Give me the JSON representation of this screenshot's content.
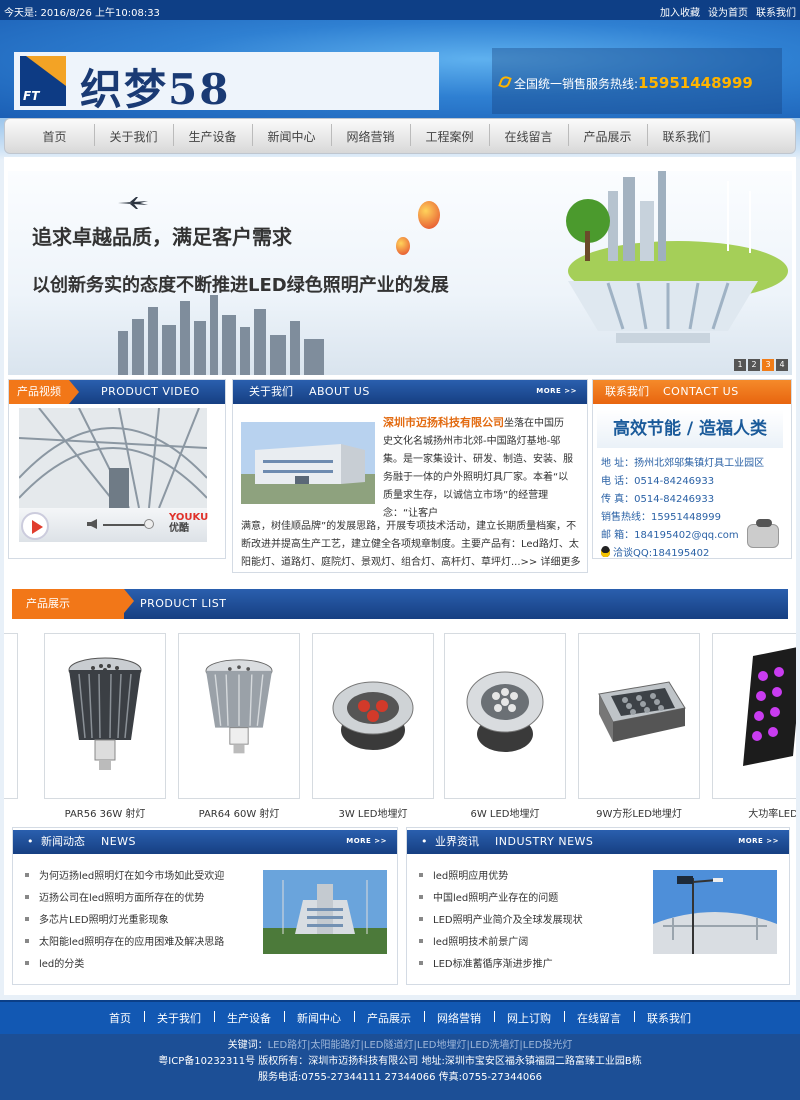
{
  "topbar": {
    "date": "今天是: 2016/8/26 上午10:08:33",
    "links": [
      "加入收藏",
      "设为首页",
      "联系我们"
    ]
  },
  "header": {
    "logo_text": "织梦58",
    "logo_mark": "FT",
    "hotline_label": "全国统一销售服务热线:",
    "hotline_number": "15951448999"
  },
  "nav": [
    "首页",
    "关于我们",
    "生产设备",
    "新闻中心",
    "网络营销",
    "工程案例",
    "在线留言",
    "产品展示",
    "联系我们"
  ],
  "banner": {
    "headline": "追求卓越品质，满足客户需求",
    "subline": "以创新务实的态度不断推进LED绿色照明产业的发展",
    "slides": [
      "1",
      "2",
      "3",
      "4"
    ],
    "active_slide": 3
  },
  "video": {
    "tag": "产品视频",
    "en": "PRODUCT VIDEO",
    "player_brand": "YOUKU",
    "player_brand_cn": "优酷"
  },
  "about": {
    "tag": "关于我们",
    "en": "ABOUT US",
    "more": "MORE >>",
    "company": "深圳市迈扬科技有限公司",
    "text_side": "坐落在中国历史文化名城扬州市北郊-中国路灯基地-邬集。是一家集设计、研发、制造、安装、服务融于一体的户外照明灯具厂家。本着“以质量求生存，以诚信立市场”的经营理念：“让客户",
    "text_full": "满意，树佳顺品牌”的发展思路，开展专项技术活动，建立长期质量档案，不断改进并提高生产工艺，建立健全各项规章制度。主要产品有：Led路灯、太阳能灯、道路灯、庭院灯、景观灯、组合灯、高杆灯、草坪灯...>> 详细更多"
  },
  "contact": {
    "tag": "联系我们",
    "en": "CONTACT US",
    "slogan": "高效节能 / 造福人类",
    "lines": [
      "地  址：扬州北郊邬集镇灯具工业园区",
      "电  话：0514-84246933",
      "传  真：0514-84246933",
      "销售热线：15951448999",
      "邮  箱：184195402@qq.com",
      "洽谈QQ:184195402"
    ]
  },
  "products": {
    "tag": "产品展示",
    "en": "PRODUCT LIST",
    "items": [
      "PAR56 36W 射灯",
      "PAR64 60W 射灯",
      "3W LED地埋灯",
      "6W LED地埋灯",
      "9W方形LED地埋灯",
      "大功率LED"
    ]
  },
  "news": {
    "title": "新闻动态",
    "en": "NEWS",
    "more": "MORE >>",
    "items": [
      "为何迈扬led照明灯在如今市场如此受欢迎",
      "迈扬公司在led照明方面所存在的优势",
      "多芯片LED照明灯光重影现象",
      "太阳能led照明存在的应用困难及解决思路",
      "led的分类"
    ]
  },
  "industry": {
    "title": "业界资讯",
    "en": "INDUSTRY NEWS",
    "more": "MORE >>",
    "items": [
      "led照明应用优势",
      "中国led照明产业存在的问题",
      "LED照明产业简介及全球发展现状",
      "led照明技术前景广阔",
      "LED标准蓄循序渐进步推广"
    ]
  },
  "footer": {
    "nav": [
      "首页",
      "关于我们",
      "生产设备",
      "新闻中心",
      "产品展示",
      "网络营销",
      "网上订购",
      "在线留言",
      "联系我们"
    ],
    "keywords_label": "关键词：",
    "keywords": "LED路灯|太阳能路灯|LED隧道灯|LED地埋灯|LED洗墙灯|LED投光灯",
    "icp": "粤ICP备10232311号 版权所有：深圳市迈扬科技有限公司 地址:深圳市宝安区福永镇福园二路富臻工业园B栋",
    "service": "服务电话:0755-27344111 27344066 传真:0755-27344066"
  },
  "colors": {
    "brand_blue": "#1c4f96",
    "accent_orange": "#f27718",
    "hotline_yellow": "#ffb400"
  }
}
